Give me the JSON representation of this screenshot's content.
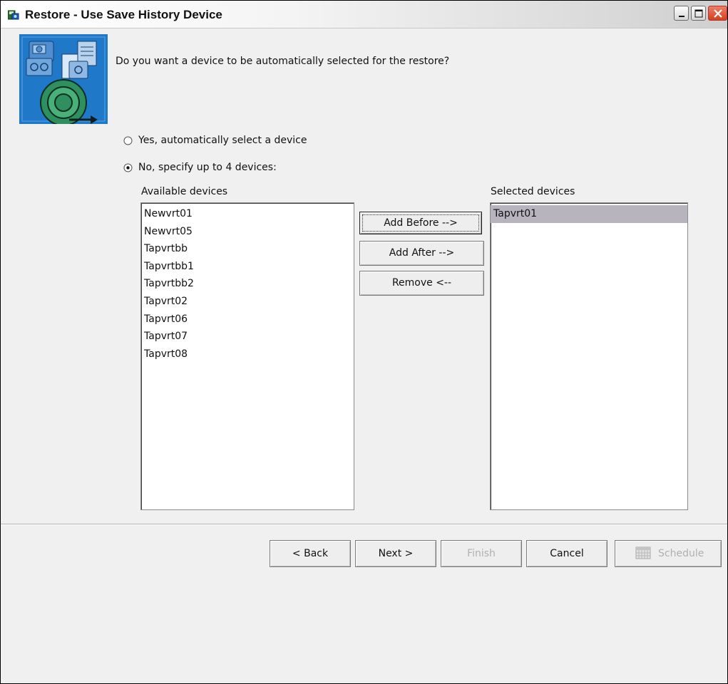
{
  "window": {
    "title": "Restore - Use Save History Device",
    "title_icon": "save-icon",
    "controls": {
      "minimize": "minimize-icon",
      "maximize": "maximize-icon",
      "close": "close-icon"
    }
  },
  "wizard": {
    "image": "tape-restore-icon",
    "question": "Do you want a device to be automatically selected for the restore?",
    "options": [
      {
        "label": "Yes, automatically select a device",
        "selected": false
      },
      {
        "label": "No, specify up to 4 devices:",
        "selected": true
      }
    ],
    "available": {
      "label": "Available devices",
      "items": [
        "Newvrt01",
        "Newvrt05",
        "Tapvrtbb",
        "Tapvrtbb1",
        "Tapvrtbb2",
        "Tapvrt02",
        "Tapvrt06",
        "Tapvrt07",
        "Tapvrt08"
      ]
    },
    "selected": {
      "label": "Selected devices",
      "items": [
        "Tapvrt01"
      ],
      "highlighted_index": 0
    },
    "transfer_buttons": {
      "add_before": "Add Before -->",
      "add_after": "Add After -->",
      "remove": "Remove <--"
    }
  },
  "footer": {
    "back": "< Back",
    "next": "Next >",
    "finish": "Finish",
    "finish_enabled": false,
    "cancel": "Cancel",
    "schedule": "Schedule",
    "schedule_enabled": false,
    "schedule_icon": "calendar-icon"
  },
  "colors": {
    "selection": "#b7b4be",
    "panel": "#f0f0f0",
    "wizard_image_bg": "#1f78c8",
    "close_button": "#d2411e"
  }
}
